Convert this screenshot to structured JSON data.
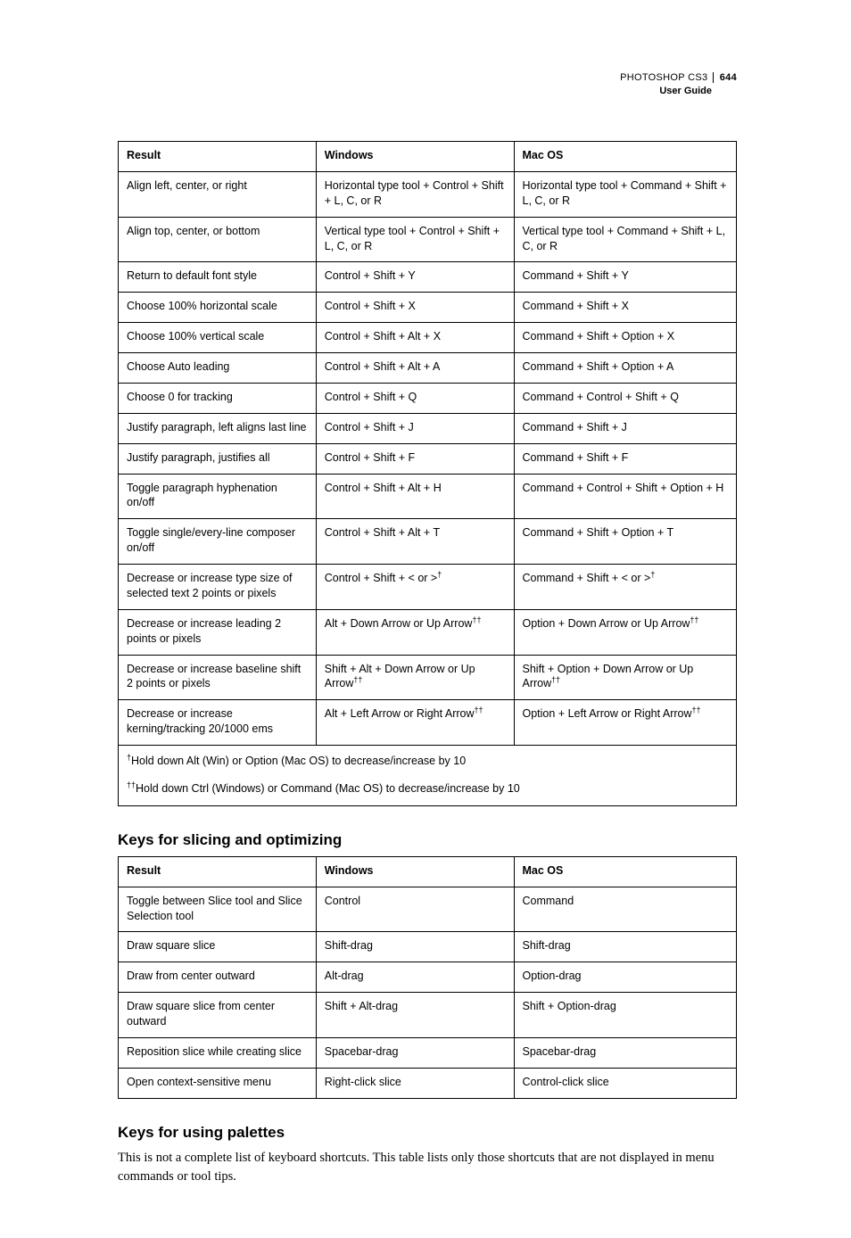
{
  "header": {
    "product": "PHOTOSHOP CS3",
    "page_number": "644",
    "subtitle": "User Guide"
  },
  "table1": {
    "headers": {
      "result": "Result",
      "windows": "Windows",
      "mac": "Mac OS"
    },
    "rows": [
      {
        "r": "Align left, center, or right",
        "w": "Horizontal type tool + Control + Shift + L, C, or R",
        "m": "Horizontal type tool + Command + Shift + L, C, or R"
      },
      {
        "r": "Align top, center, or bottom",
        "w": "Vertical type tool + Control + Shift + L, C, or R",
        "m": "Vertical type tool + Command + Shift + L, C, or R"
      },
      {
        "r": "Return to default font style",
        "w": "Control + Shift + Y",
        "m": "Command + Shift + Y"
      },
      {
        "r": "Choose 100% horizontal scale",
        "w": "Control + Shift + X",
        "m": "Command + Shift + X"
      },
      {
        "r": "Choose 100% vertical scale",
        "w": "Control + Shift + Alt + X",
        "m": "Command + Shift + Option + X"
      },
      {
        "r": "Choose Auto leading",
        "w": "Control + Shift + Alt + A",
        "m": "Command + Shift + Option + A"
      },
      {
        "r": "Choose 0 for tracking",
        "w": "Control + Shift + Q",
        "m": "Command + Control + Shift + Q"
      },
      {
        "r": "Justify paragraph, left aligns last line",
        "w": "Control + Shift + J",
        "m": "Command + Shift + J"
      },
      {
        "r": "Justify paragraph, justifies all",
        "w": "Control + Shift + F",
        "m": "Command + Shift + F"
      },
      {
        "r": "Toggle paragraph hyphenation on/off",
        "w": "Control + Shift + Alt + H",
        "m": "Command + Control + Shift + Option + H"
      },
      {
        "r": "Toggle single/every-line composer on/off",
        "w": "Control + Shift + Alt + T",
        "m": "Command + Shift + Option + T"
      },
      {
        "r": "Decrease or increase type size of selected text 2 points or pixels",
        "w": "Control + Shift + < or >",
        "w_sup": "†",
        "m": "Command + Shift + < or >",
        "m_sup": "†"
      },
      {
        "r": "Decrease or increase leading 2 points or pixels",
        "w": "Alt + Down Arrow or Up Arrow",
        "w_sup": "††",
        "m": "Option + Down Arrow or Up Arrow",
        "m_sup": "††"
      },
      {
        "r": "Decrease or increase baseline shift 2 points or pixels",
        "w": "Shift + Alt + Down Arrow or Up Arrow",
        "w_sup": "††",
        "m": "Shift + Option + Down Arrow or Up Arrow",
        "m_sup": "††"
      },
      {
        "r": "Decrease or increase kerning/tracking 20/1000 ems",
        "w": "Alt + Left Arrow or Right Arrow",
        "w_sup": "††",
        "m": "Option + Left Arrow or Right Arrow",
        "m_sup": "††"
      }
    ],
    "footnotes": {
      "f1_sup": "†",
      "f1": "Hold down Alt (Win) or Option (Mac OS) to decrease/increase by 10",
      "f2_sup": "††",
      "f2": "Hold down Ctrl (Windows) or Command (Mac OS) to decrease/increase by 10"
    }
  },
  "section2": {
    "title": "Keys for slicing and optimizing",
    "headers": {
      "result": "Result",
      "windows": "Windows",
      "mac": "Mac OS"
    },
    "rows": [
      {
        "r": "Toggle between Slice tool and Slice Selection tool",
        "w": "Control",
        "m": "Command"
      },
      {
        "r": "Draw square slice",
        "w": "Shift-drag",
        "m": "Shift-drag"
      },
      {
        "r": "Draw from center outward",
        "w": "Alt-drag",
        "m": "Option-drag"
      },
      {
        "r": "Draw square slice from center outward",
        "w": "Shift + Alt-drag",
        "m": "Shift + Option-drag"
      },
      {
        "r": "Reposition slice while creating slice",
        "w": "Spacebar-drag",
        "m": "Spacebar-drag"
      },
      {
        "r": "Open context-sensitive menu",
        "w": "Right-click slice",
        "m": "Control-click slice"
      }
    ]
  },
  "section3": {
    "title": "Keys for using palettes",
    "intro": "This is not a complete list of keyboard shortcuts. This table lists only those shortcuts that are not displayed in menu commands or tool tips."
  }
}
